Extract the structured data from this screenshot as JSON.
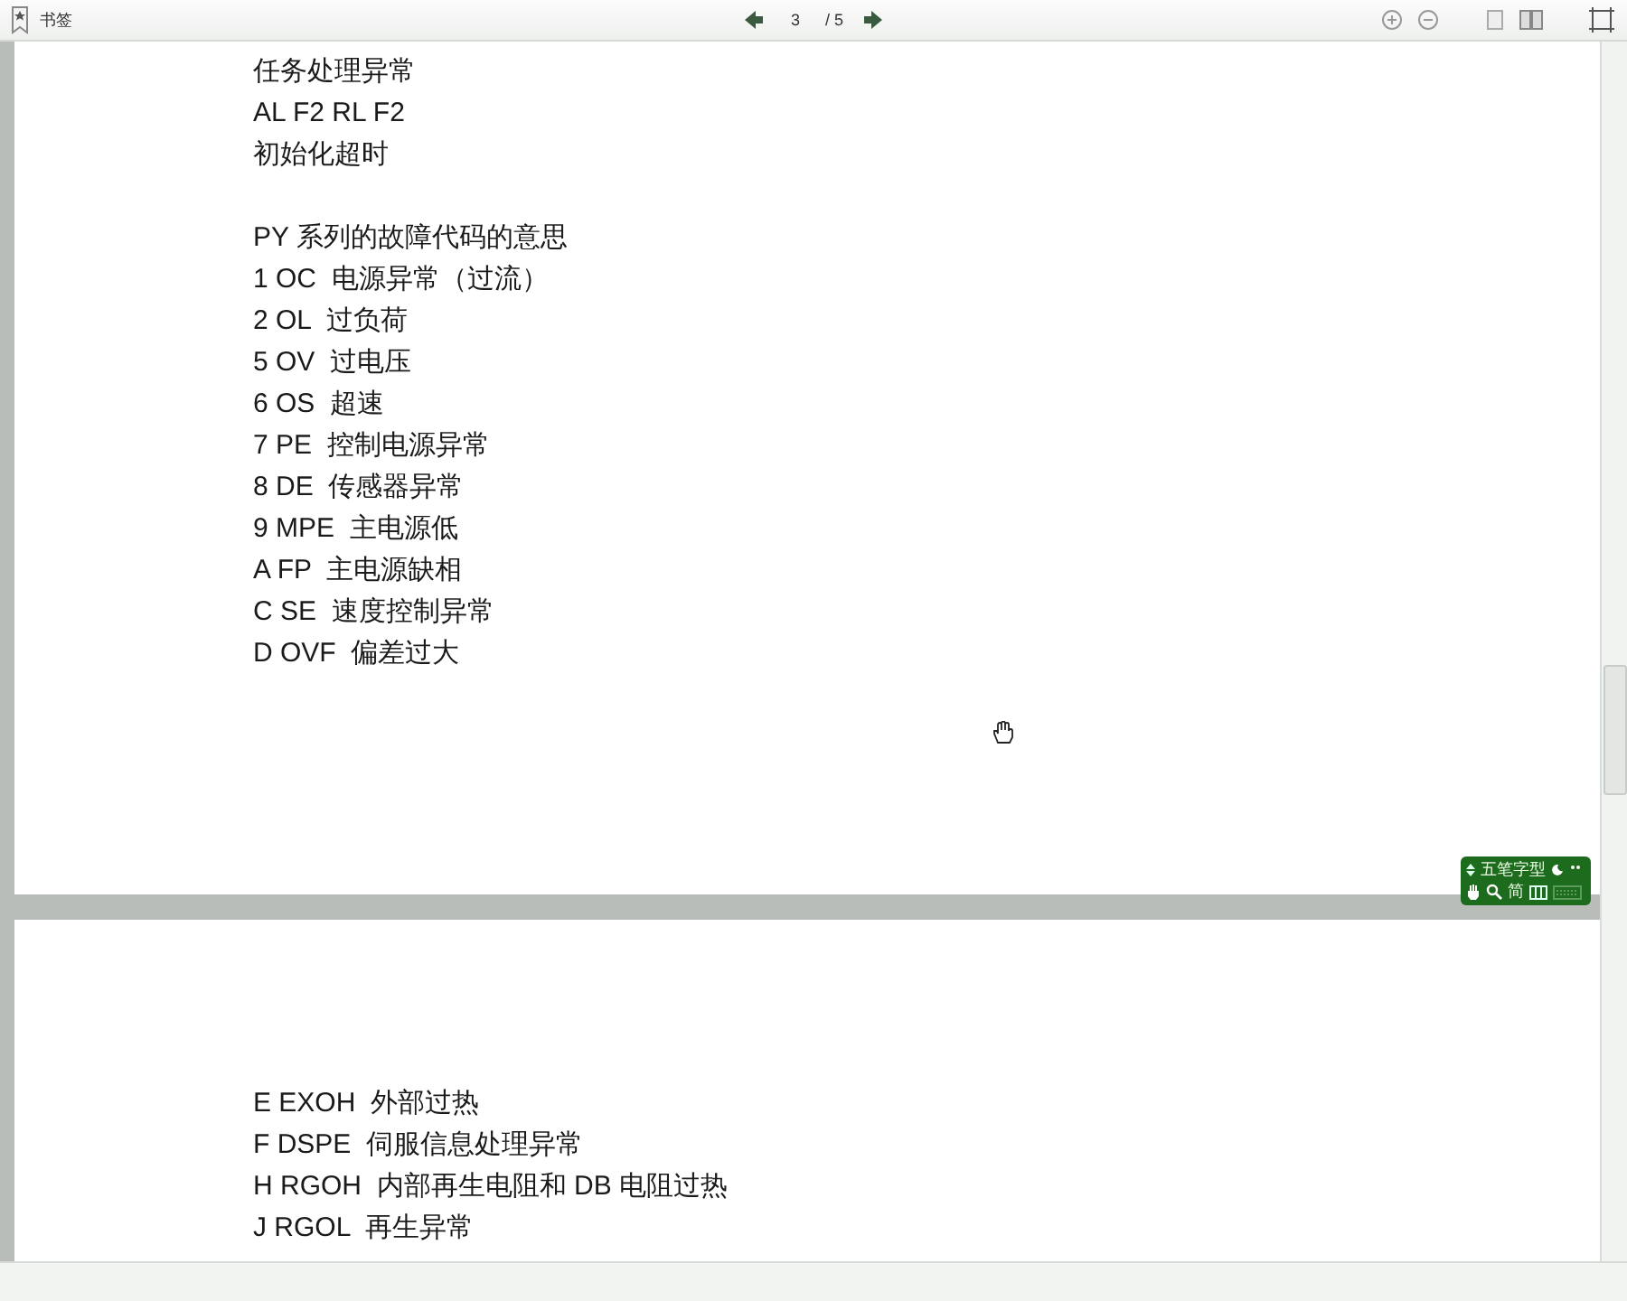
{
  "toolbar": {
    "bookmarks_label": "书签",
    "page_current": "3",
    "page_total": "/ 5"
  },
  "pages": [
    {
      "paragraphs": [
        [
          "任务处理异常",
          "AL F2 RL F2",
          "初始化超时"
        ],
        [
          "PY 系列的故障代码的意思",
          "1 OC  电源异常（过流）",
          "2 OL  过负荷",
          "5 OV  过电压",
          "6 OS  超速",
          "7 PE  控制电源异常",
          "8 DE  传感器异常",
          "9 MPE  主电源低",
          "A FP  主电源缺相",
          "C SE  速度控制异常",
          "D OVF  偏差过大"
        ]
      ]
    },
    {
      "paragraphs": [
        [
          "E EXOH  外部过热",
          "F DSPE  伺服信息处理异常",
          "H RGOH  内部再生电阻和 DB 电阻过热",
          "J RGOL  再生异常"
        ]
      ]
    }
  ],
  "ime": {
    "mode_label": "五笔字型",
    "script_label": "简"
  }
}
